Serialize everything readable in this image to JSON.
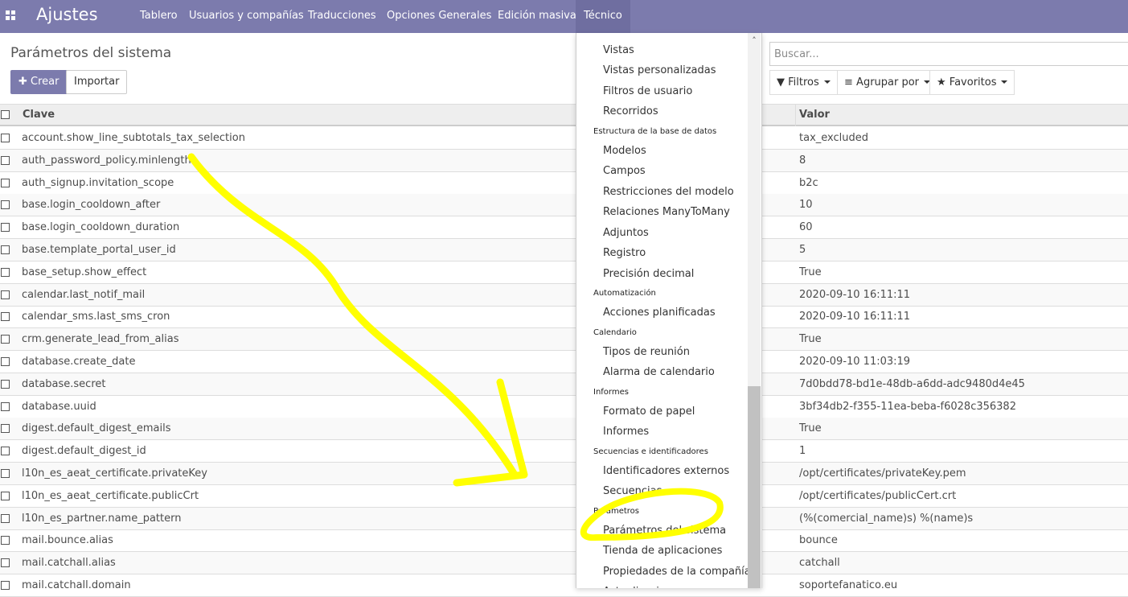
{
  "navbar": {
    "brand": "Ajustes",
    "menu": [
      "Tablero",
      "Usuarios y compañías",
      "Traducciones",
      "Opciones Generales",
      "Edición masiva",
      "Técnico"
    ]
  },
  "page": {
    "title": "Parámetros del sistema",
    "create_label": "Crear",
    "import_label": "Importar"
  },
  "search": {
    "placeholder": "Buscar...",
    "filters_label": "Filtros",
    "group_label": "Agrupar por",
    "favorites_label": "Favoritos"
  },
  "table": {
    "columns": [
      "Clave",
      "Valor"
    ],
    "rows": [
      {
        "key": "account.show_line_subtotals_tax_selection",
        "value": "tax_excluded"
      },
      {
        "key": "auth_password_policy.minlength",
        "value": "8"
      },
      {
        "key": "auth_signup.invitation_scope",
        "value": "b2c"
      },
      {
        "key": "base.login_cooldown_after",
        "value": "10"
      },
      {
        "key": "base.login_cooldown_duration",
        "value": "60"
      },
      {
        "key": "base.template_portal_user_id",
        "value": "5"
      },
      {
        "key": "base_setup.show_effect",
        "value": "True"
      },
      {
        "key": "calendar.last_notif_mail",
        "value": "2020-09-10 16:11:11"
      },
      {
        "key": "calendar_sms.last_sms_cron",
        "value": "2020-09-10 16:11:11"
      },
      {
        "key": "crm.generate_lead_from_alias",
        "value": "True"
      },
      {
        "key": "database.create_date",
        "value": "2020-09-10 11:03:19"
      },
      {
        "key": "database.secret",
        "value": "7d0bdd78-bd1e-48db-a6dd-adc9480d4e45"
      },
      {
        "key": "database.uuid",
        "value": "3bf34db2-f355-11ea-beba-f6028c356382"
      },
      {
        "key": "digest.default_digest_emails",
        "value": "True"
      },
      {
        "key": "digest.default_digest_id",
        "value": "1"
      },
      {
        "key": "l10n_es_aeat_certificate.privateKey",
        "value": "/opt/certificates/privateKey.pem"
      },
      {
        "key": "l10n_es_aeat_certificate.publicCrt",
        "value": "/opt/certificates/publicCert.crt"
      },
      {
        "key": "l10n_es_partner.name_pattern",
        "value": "(%(comercial_name)s) %(name)s"
      },
      {
        "key": "mail.bounce.alias",
        "value": "bounce"
      },
      {
        "key": "mail.catchall.alias",
        "value": "catchall"
      },
      {
        "key": "mail.catchall.domain",
        "value": "soportefanatico.eu"
      }
    ]
  },
  "dropdown": {
    "entries": [
      {
        "type": "item",
        "label": "Vistas"
      },
      {
        "type": "item",
        "label": "Vistas personalizadas"
      },
      {
        "type": "item",
        "label": "Filtros de usuario"
      },
      {
        "type": "item",
        "label": "Recorridos"
      },
      {
        "type": "header",
        "label": "Estructura de la base de datos"
      },
      {
        "type": "item",
        "label": "Modelos"
      },
      {
        "type": "item",
        "label": "Campos"
      },
      {
        "type": "item",
        "label": "Restricciones del modelo"
      },
      {
        "type": "item",
        "label": "Relaciones ManyToMany"
      },
      {
        "type": "item",
        "label": "Adjuntos"
      },
      {
        "type": "item",
        "label": "Registro"
      },
      {
        "type": "item",
        "label": "Precisión decimal"
      },
      {
        "type": "header",
        "label": "Automatización"
      },
      {
        "type": "item",
        "label": "Acciones planificadas"
      },
      {
        "type": "header",
        "label": "Calendario"
      },
      {
        "type": "item",
        "label": "Tipos de reunión"
      },
      {
        "type": "item",
        "label": "Alarma de calendario"
      },
      {
        "type": "header",
        "label": "Informes"
      },
      {
        "type": "item",
        "label": "Formato de papel"
      },
      {
        "type": "item",
        "label": "Informes"
      },
      {
        "type": "header",
        "label": "Secuencias e identificadores"
      },
      {
        "type": "item",
        "label": "Identificadores externos"
      },
      {
        "type": "item",
        "label": "Secuencias"
      },
      {
        "type": "header",
        "label": "Parámetros"
      },
      {
        "type": "item",
        "label": "Parámetros del sistema"
      },
      {
        "type": "item",
        "label": "Tienda de aplicaciones"
      },
      {
        "type": "item",
        "label": "Propiedades de la compañía"
      },
      {
        "type": "item",
        "label": "Actualizaciones"
      }
    ]
  },
  "colors": {
    "brand": "#7c7bad",
    "annotation": "#ffff00"
  }
}
